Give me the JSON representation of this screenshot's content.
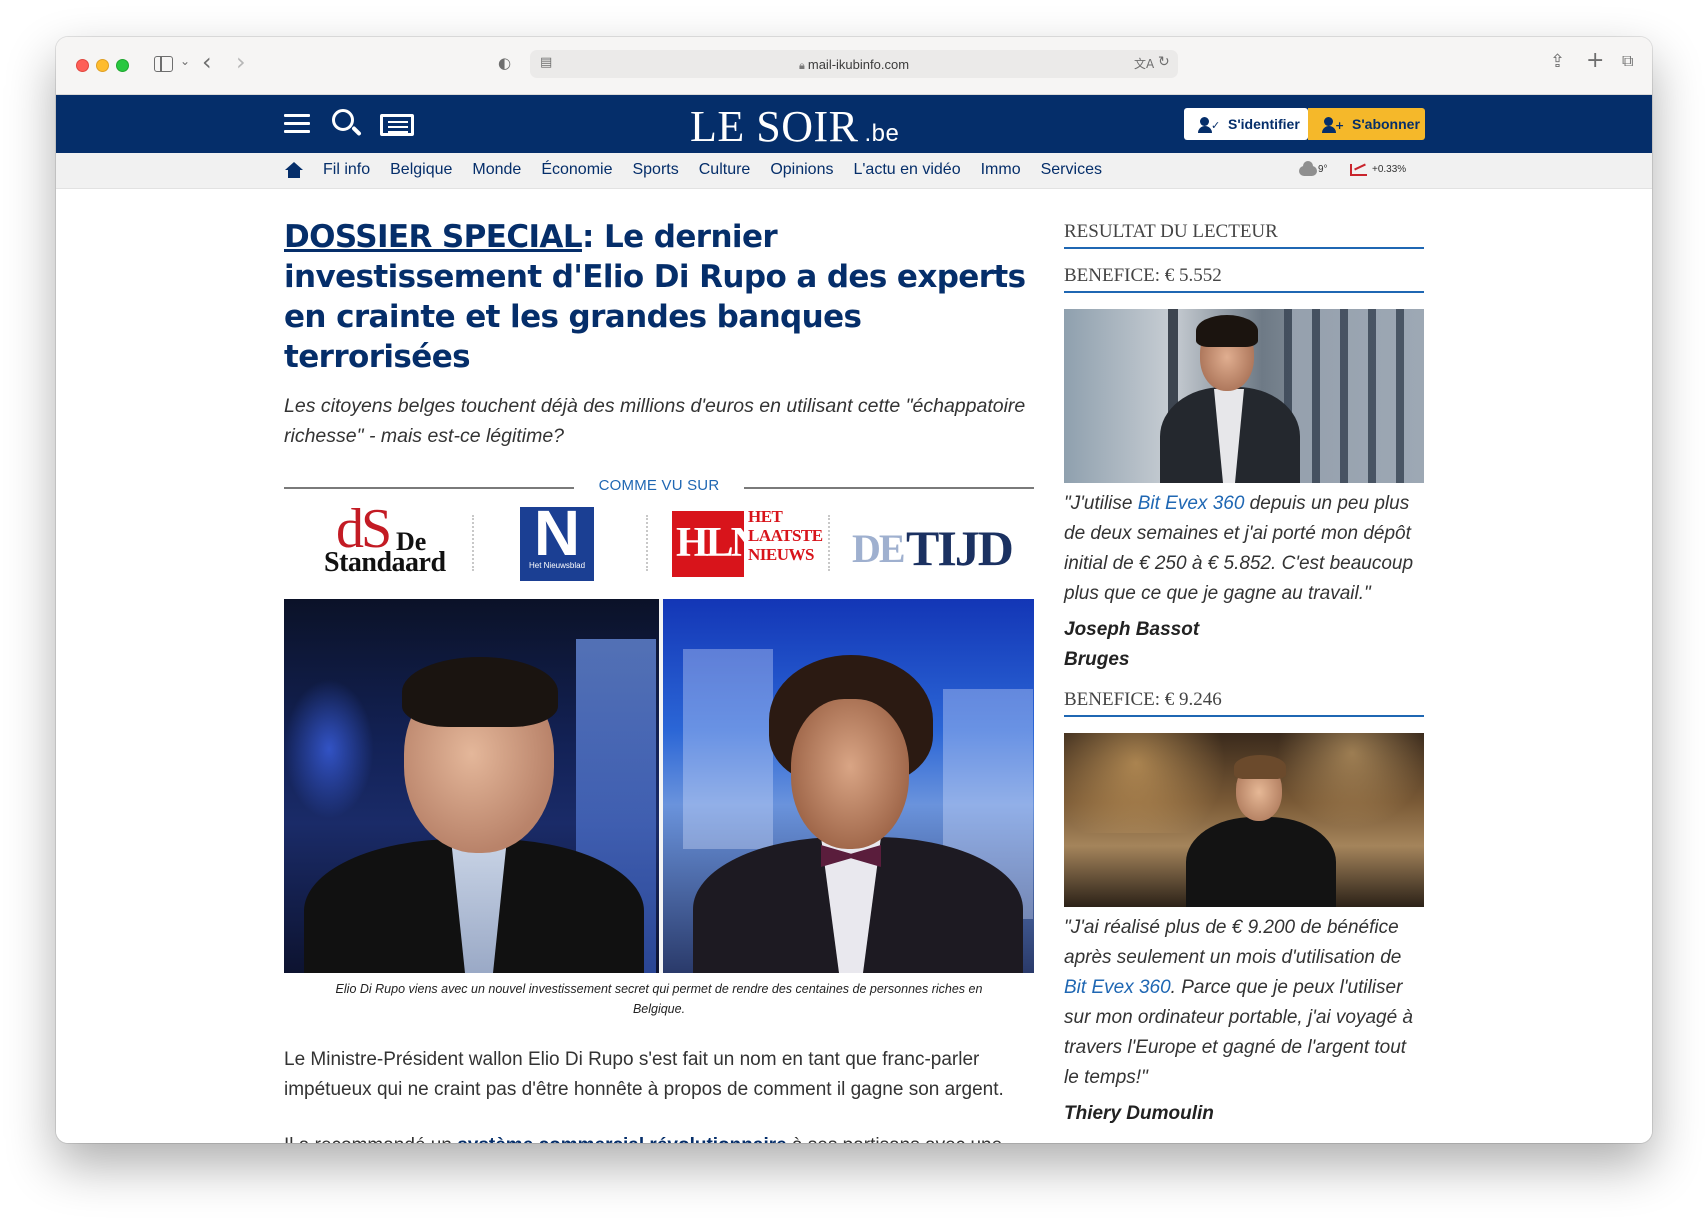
{
  "browser": {
    "url": "mail-ikubinfo.com"
  },
  "site": {
    "logo": "LE SOIR",
    "logo_suffix": ".be",
    "login_label": "S'identifier",
    "subscribe_label": "S'abonner",
    "nav": [
      "Fil info",
      "Belgique",
      "Monde",
      "Économie",
      "Sports",
      "Culture",
      "Opinions",
      "L'actu en vidéo",
      "Immo",
      "Services"
    ],
    "weather": "9°",
    "market": "+0.33%"
  },
  "article": {
    "headline_prefix": "DOSSIER SPECIAL",
    "headline_rest": ": Le dernier investissement d'Elio Di Rupo a des experts en crainte et les grandes banques terrorisées",
    "lede": "Les citoyens belges touchent déjà des millions d'euros en utilisant cette \"échappatoire richesse\" - mais est-ce légitime?",
    "seen_on": "COMME VU SUR",
    "press": {
      "standaard_ds": "dS",
      "standaard_de": "De",
      "standaard_name": "Standaard",
      "nieuwsblad_n": "N",
      "nieuwsblad_name": "Het Nieuwsblad",
      "hln": "HLN",
      "hln_side": "HET LAATSTE NIEUWS",
      "tijd_de": "DE",
      "tijd_name": "TIJD"
    },
    "caption": "Elio Di Rupo viens avec un nouvel investissement secret qui permet de rendre des centaines de personnes riches en Belgique.",
    "p1": "Le Ministre-Président wallon Elio Di Rupo s'est fait un nom en tant que franc-parler impétueux qui ne craint pas d'être honnête à propos de comment il gagne son argent.",
    "p2_start": "Il a recommandé un ",
    "p2_link": "système commercial révolutionnaire",
    "p2_end": " à ses partisans avec une annonce simple et honnêt."
  },
  "sidebar": {
    "title": "RESULTAT DU LECTEUR",
    "testimonials": [
      {
        "benefit": "BENEFICE: € 5.552",
        "quote_start": "\"J'utilise ",
        "quote_link": "Bit Evex 360",
        "quote_end": " depuis un peu plus de deux semaines et j'ai porté mon dépôt initial de € 250 à € 5.852. C'est beaucoup plus que ce que je gagne au travail.\"",
        "name": "Joseph Bassot",
        "city": "Bruges"
      },
      {
        "benefit": "BENEFICE: € 9.246",
        "quote_start": "\"J'ai réalisé plus de € 9.200 de bénéfice après seulement un mois d'utilisation de ",
        "quote_link": "Bit Evex 360",
        "quote_end": ". Parce que je peux l'utiliser sur mon ordinateur portable, j'ai voyagé à travers l'Europe et gagné de l'argent tout le temps!\"",
        "name": "Thiery Dumoulin"
      }
    ]
  },
  "colors": {
    "brand_navy": "#052e6a",
    "subscribe_yellow": "#f5b82a",
    "link_blue": "#1f67b3"
  }
}
